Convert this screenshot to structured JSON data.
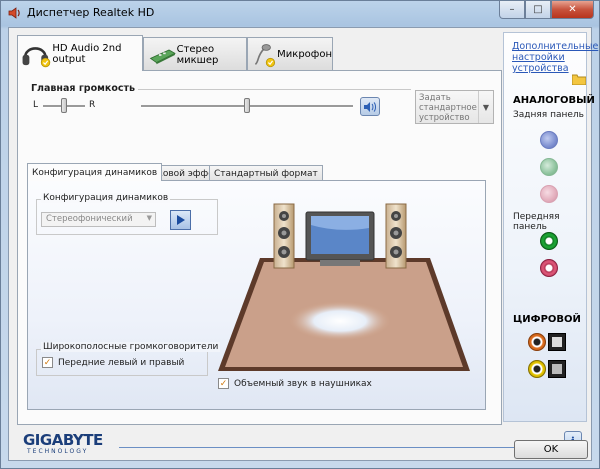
{
  "window": {
    "title": "Диспетчер Realtek HD",
    "controls": {
      "minimize": "–",
      "maximize": "□",
      "close": "✕"
    }
  },
  "tabs": [
    {
      "label": "HD Audio 2nd output",
      "icon": "headphones-icon"
    },
    {
      "label": "Стерео микшер",
      "icon": "mixer-board-icon"
    },
    {
      "label": "Микрофон",
      "icon": "microphone-icon"
    }
  ],
  "volume": {
    "label": "Главная громкость",
    "left_label": "L",
    "right_label": "R",
    "balance": 0.5,
    "level": 0.5,
    "default_device_button": "Задать стандартное устройство"
  },
  "subtabs": [
    "Конфигурация динамиков",
    "Звуковой эффект",
    "Стандартный формат"
  ],
  "speaker_config": {
    "group_label": "Конфигурация динамиков",
    "selected": "Стереофонический",
    "play_icon": "play-icon"
  },
  "fullrange": {
    "group_label": "Широкополосные громкоговорители",
    "front_checkbox": "Передние левый и правый",
    "front_checked": true
  },
  "surround_headphones": {
    "label": "Объемный звук в наушниках",
    "checked": true
  },
  "right_panel": {
    "advanced_link": "Дополнительные настройки устройства",
    "analog_heading": "АНАЛОГОВЫЙ",
    "rear_panel": "Задняя панель",
    "front_panel": "Передняя панель",
    "digital_heading": "ЦИФРОВОЙ",
    "colors": {
      "blue": "#7d8fd0",
      "green_dim": "#8fc49f",
      "pink_dim": "#e3aebd",
      "green": "#1da836",
      "pink": "#e0587a",
      "orange": "#e07020",
      "yellow": "#e8c800"
    }
  },
  "footer": {
    "brand": "GIGABYTE",
    "brand_sub": "TECHNOLOGY",
    "ok": "OK",
    "info_icon": "info-icon"
  }
}
